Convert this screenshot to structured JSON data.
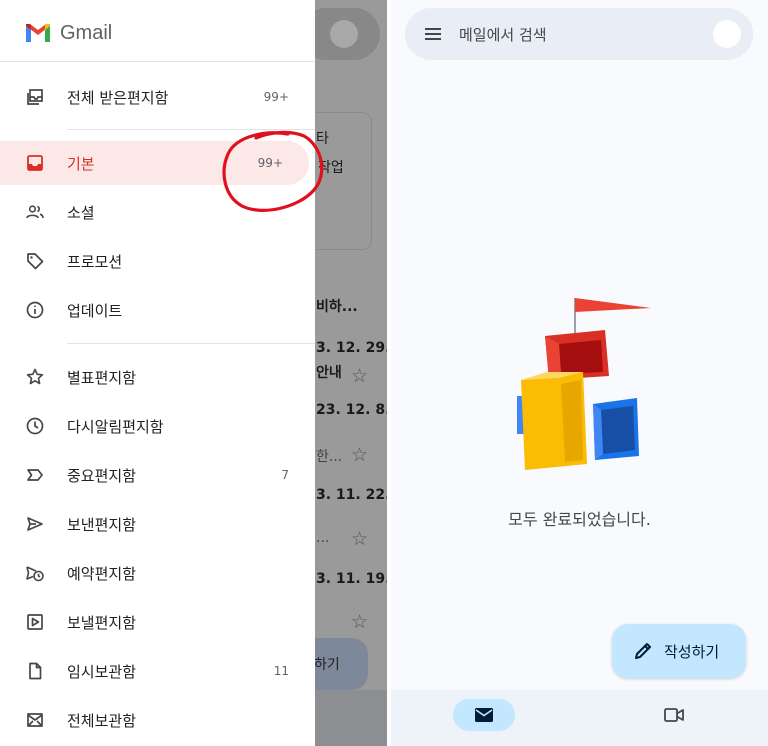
{
  "drawer": {
    "brand": "Gmail",
    "items": [
      {
        "label": "전체 받은편지함",
        "count": "99+",
        "icon": "all-inboxes-icon"
      },
      {
        "label": "기본",
        "count": "99+",
        "icon": "inbox-icon",
        "active": true
      },
      {
        "label": "소셜",
        "count": "",
        "icon": "people-icon"
      },
      {
        "label": "프로모션",
        "count": "",
        "icon": "tag-icon"
      },
      {
        "label": "업데이트",
        "count": "",
        "icon": "info-icon"
      },
      {
        "label": "별표편지함",
        "count": "",
        "icon": "star-icon"
      },
      {
        "label": "다시알림편지함",
        "count": "",
        "icon": "clock-icon"
      },
      {
        "label": "중요편지함",
        "count": "7",
        "icon": "label-important-icon"
      },
      {
        "label": "보낸편지함",
        "count": "",
        "icon": "send-icon"
      },
      {
        "label": "예약편지함",
        "count": "",
        "icon": "schedule-send-icon"
      },
      {
        "label": "보낼편지함",
        "count": "",
        "icon": "outbox-icon"
      },
      {
        "label": "임시보관함",
        "count": "11",
        "icon": "draft-icon"
      },
      {
        "label": "전체보관함",
        "count": "",
        "icon": "all-mail-icon"
      }
    ]
  },
  "behind": {
    "fragments": [
      "타",
      "작업",
      "비하...",
      "3. 12. 29.",
      "안내",
      "23. 12. 8.",
      "한...",
      "3. 11. 22.",
      "...",
      "3. 11. 19.",
      "하기"
    ]
  },
  "right": {
    "search_placeholder": "메일에서 검색",
    "empty_message": "모두 완료되었습니다.",
    "compose_label": "작성하기"
  },
  "colors": {
    "active_bg": "#fce8e6",
    "active_text": "#d93025",
    "fab_bg": "#c2e7ff",
    "annotation": "#e0101e"
  }
}
